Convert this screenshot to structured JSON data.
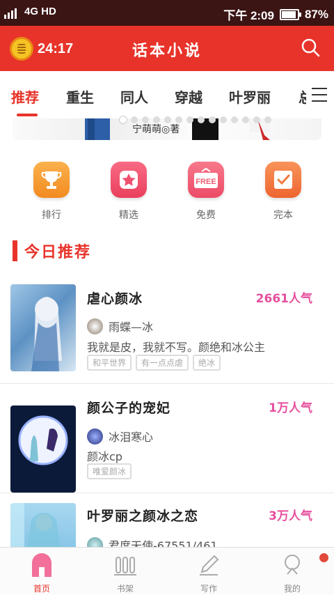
{
  "status": {
    "network": "4G HD",
    "time": "下午 2:09",
    "battery": "87%",
    "battery_level": 0.87
  },
  "app": {
    "title": "话本小说",
    "timer": "24:17"
  },
  "tabs": [
    "推荐",
    "重生",
    "同人",
    "穿越",
    "叶罗丽",
    "总"
  ],
  "banner": {
    "caption": "宁萌萌◎著"
  },
  "quick": [
    {
      "label": "排行",
      "color": "#f59a35",
      "icon": "trophy-icon"
    },
    {
      "label": "精选",
      "color": "#f2536a",
      "icon": "star-icon"
    },
    {
      "label": "免费",
      "color": "#ef5b73",
      "icon": "free-tag-icon",
      "badge": "FREE"
    },
    {
      "label": "完本",
      "color": "#f27a3a",
      "icon": "check-icon"
    }
  ],
  "section": {
    "title": "今日推荐"
  },
  "books": [
    {
      "title": "虐心颜冰",
      "popularity": "2661人气",
      "author": "雨蝶—冰",
      "desc": "我就是皮，我就不写。颜绝和冰公主",
      "tags": [
        "和平世界",
        "有一点点虐",
        "绝冰"
      ]
    },
    {
      "title": "颜公子的宠妃",
      "popularity": "1万人气",
      "author": "冰泪寒心",
      "desc": "颜冰cp",
      "tags": [
        "唯爱颜冰"
      ]
    },
    {
      "title": "叶罗丽之颜冰之恋",
      "popularity": "3万人气",
      "author": "君度天使-67551/461",
      "desc": "",
      "tags": []
    }
  ],
  "nav": [
    {
      "label": "首页",
      "icon": "home-icon",
      "active": true
    },
    {
      "label": "书架",
      "icon": "bookshelf-icon",
      "active": false
    },
    {
      "label": "写作",
      "icon": "pen-icon",
      "active": false
    },
    {
      "label": "我的",
      "icon": "profile-icon",
      "active": false
    }
  ],
  "colors": {
    "accent": "#e8332a",
    "popularity": "#e64f9d",
    "statusbar": "#3b1414"
  }
}
